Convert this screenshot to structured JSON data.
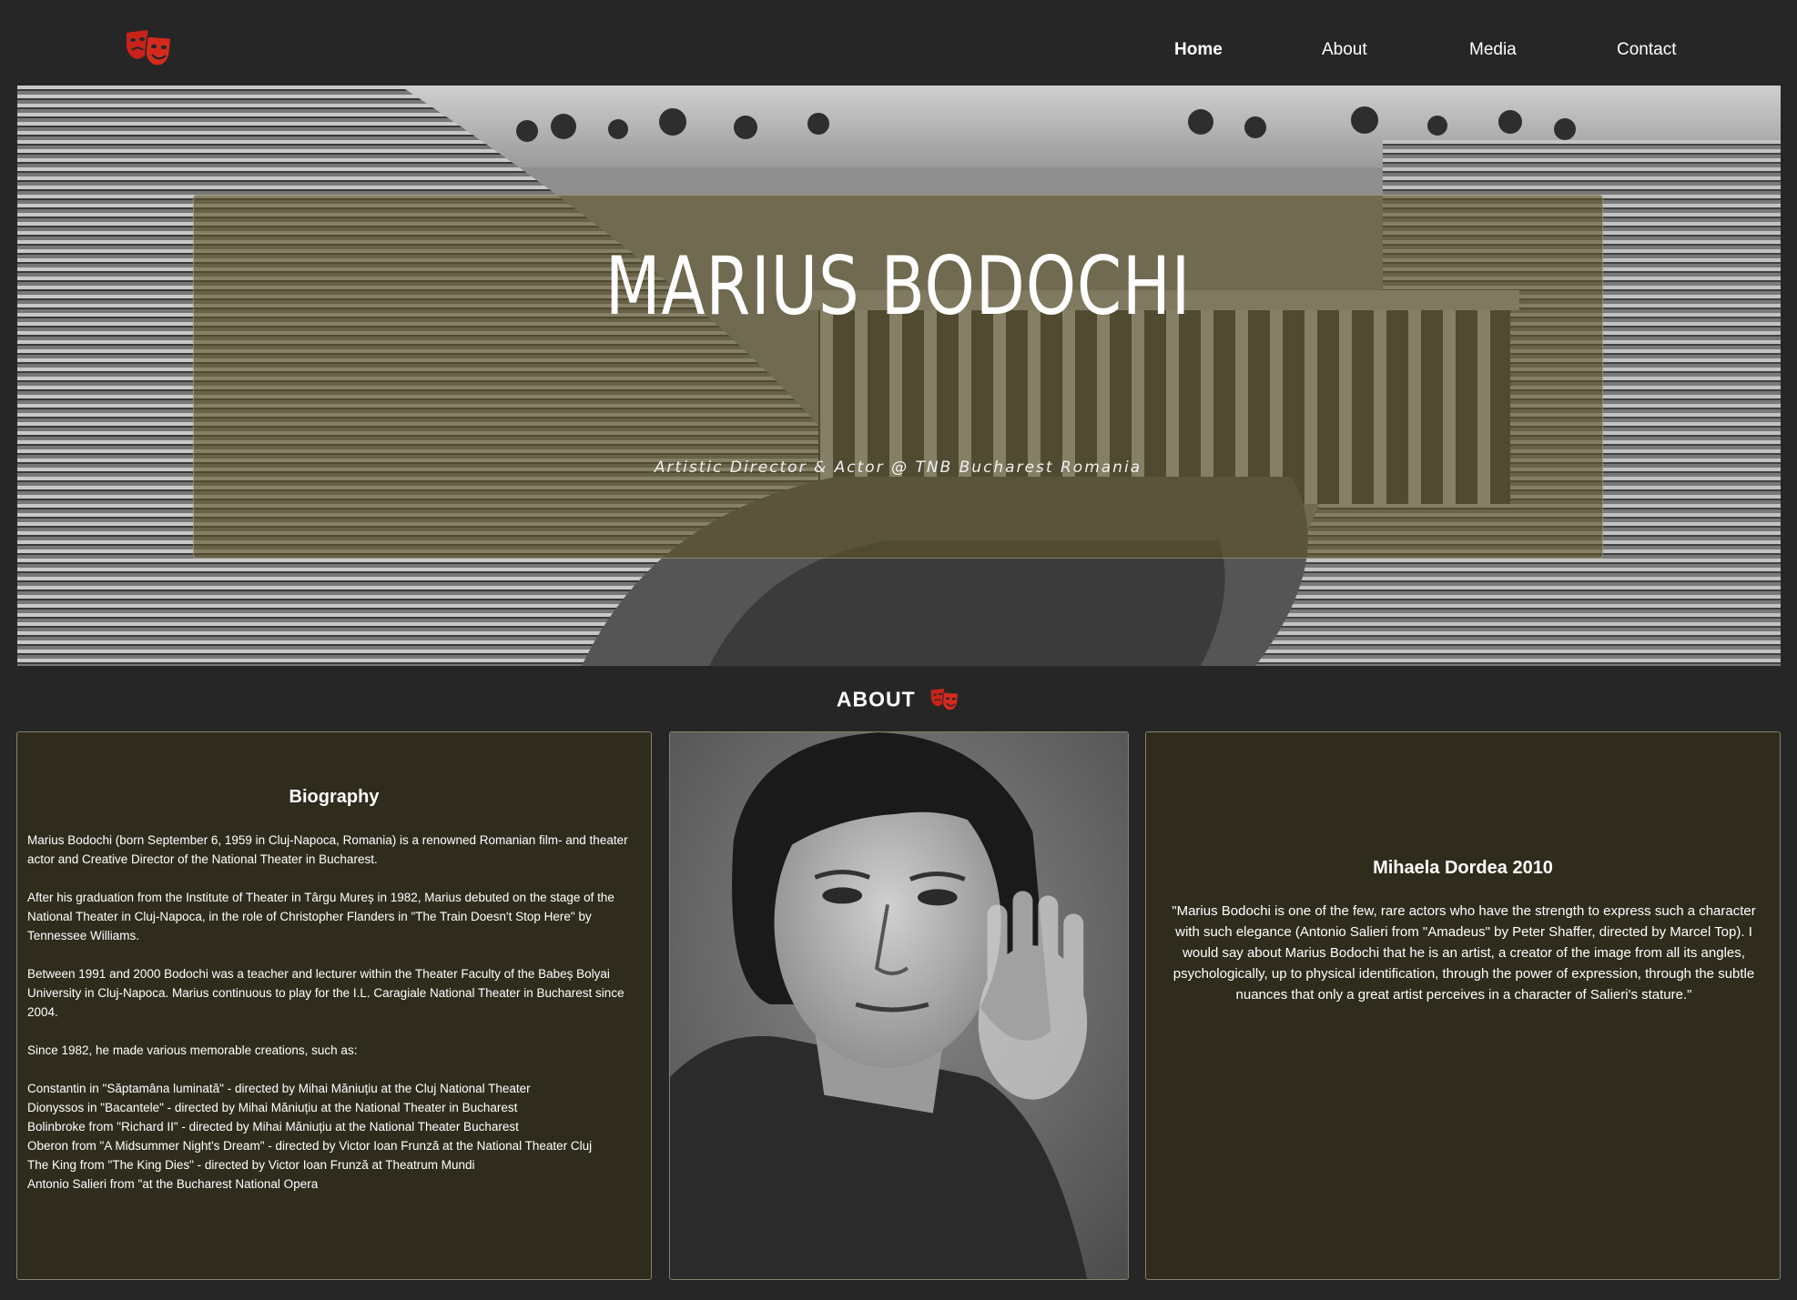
{
  "nav": {
    "logo_icon": "theater-masks-icon",
    "items": [
      {
        "label": "Home",
        "active": true
      },
      {
        "label": "About",
        "active": false
      },
      {
        "label": "Media",
        "active": false
      },
      {
        "label": "Contact",
        "active": false
      }
    ]
  },
  "hero": {
    "title": "MARIUS BODOCHI",
    "subtitle": "Artistic Director & Actor @ TNB Bucharest Romania"
  },
  "about": {
    "heading": "ABOUT",
    "heading_icon": "theater-masks-icon"
  },
  "biography": {
    "title": "Biography",
    "paragraphs": [
      "Marius Bodochi (born September 6, 1959 in Cluj-Napoca, Romania) is a renowned Romanian film- and theater actor and Creative Director of the National Theater in Bucharest.",
      "After his graduation from the Institute of Theater in Târgu Mureș in 1982, Marius debuted on the stage of the National Theater in Cluj-Napoca, in the role of Christopher Flanders in \"The Train Doesn't Stop Here\" by Tennessee Williams.",
      "Between 1991 and 2000 Bodochi was a teacher and lecturer within the Theater Faculty of the Babeș Bolyai University in Cluj-Napoca. Marius continuous to play for the I.L. Caragiale National Theater in Bucharest since 2004.",
      "Since 1982, he made various memorable creations, such as:"
    ],
    "roles": [
      "Constantin in \"Săptamâna luminată\" - directed by Mihai Măniuțiu at the Cluj National Theater",
      "Dionyssos in \"Bacantele\" - directed by Mihai Măniuțiu at the National Theater in Bucharest",
      "Bolinbroke from \"Richard II\" - directed by Mihai Măniuțiu at the National Theater Bucharest",
      "Oberon from \"A Midsummer Night's Dream\" - directed by Victor Ioan Frunză at the National Theater Cluj",
      "The King from \"The King Dies\" - directed by Victor Ioan Frunză at Theatrum Mundi",
      "Antonio Salieri from \"at the Bucharest National Opera"
    ]
  },
  "quote": {
    "title": "Mihaela Dordea 2010",
    "text": "\"Marius Bodochi is one of the few, rare actors who have the strength to express such a character with such elegance (Antonio Salieri from \"Amadeus\" by Peter Shaffer, directed by Marcel Top). I would say about Marius Bodochi that he is an artist, a creator of the image from all its angles, psychologically, up to physical identification, through the power of expression, through the subtle nuances that only a great artist perceives in a character of Salieri's stature.\""
  },
  "colors": {
    "background": "#262626",
    "card_bg": "#302c1d",
    "accent_red": "#d42a1e",
    "hero_overlay": "#5c542a"
  }
}
